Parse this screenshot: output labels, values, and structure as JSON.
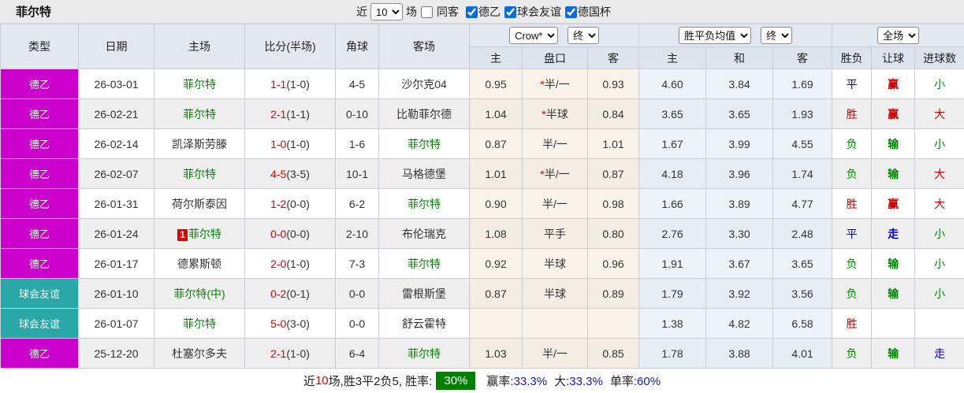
{
  "title": "菲尔特",
  "controls": {
    "near_label": "近",
    "games_select": "10",
    "games_label": "场",
    "same_away_label": "同客",
    "filters": [
      {
        "label": "德乙",
        "checked": true
      },
      {
        "label": "球会友谊",
        "checked": true
      },
      {
        "label": "德国杯",
        "checked": true
      }
    ]
  },
  "header": {
    "type": "类型",
    "date": "日期",
    "home": "主场",
    "score": "比分(半场)",
    "corner": "角球",
    "away": "客场",
    "odds_select": "Crow*",
    "odds_final_select": "终",
    "avg_select": "胜平负均值",
    "avg_final_select": "终",
    "scope_select": "全场",
    "odds_home": "主",
    "odds_handicap": "盘口",
    "odds_away": "客",
    "avg_home": "主",
    "avg_draw": "和",
    "avg_away": "客",
    "wl": "胜负",
    "handicap_res": "让球",
    "goals_res": "进球数"
  },
  "highlight_team": "菲尔特",
  "colors": {
    "type_map": {
      "德乙": "#cc00cc",
      "球会友谊": "#2aa7a7"
    },
    "result_map": {
      "胜": "#cc0000",
      "赢": "#cc0000",
      "大": "#cc0000",
      "负": "#008800",
      "输": "#008800",
      "小": "#008800",
      "平": "#0000cc",
      "走": "#0000cc"
    },
    "team_highlight": "#008800",
    "score_ft": "#e40000",
    "win_rate_badge_bg": "#008000"
  },
  "rows": [
    {
      "type": "德乙",
      "date": "26-03-01",
      "badge": "",
      "home": "菲尔特",
      "ft": "1-1",
      "ht": "(1-0)",
      "corner": "4-5",
      "away": "沙尔克04",
      "o1": "0.95",
      "star": "*",
      "pan": "半/一",
      "o2": "0.93",
      "a1": "4.60",
      "a2": "3.84",
      "a3": "1.69",
      "wl": "平",
      "hr": "赢",
      "gr": "小"
    },
    {
      "type": "德乙",
      "date": "26-02-21",
      "badge": "",
      "home": "菲尔特",
      "ft": "2-1",
      "ht": "(1-1)",
      "corner": "0-10",
      "away": "比勒菲尔德",
      "o1": "1.04",
      "star": "*",
      "pan": "半球",
      "o2": "0.84",
      "a1": "3.65",
      "a2": "3.65",
      "a3": "1.93",
      "wl": "胜",
      "hr": "赢",
      "gr": "大"
    },
    {
      "type": "德乙",
      "date": "26-02-14",
      "badge": "",
      "home": "凯泽斯劳滕",
      "ft": "1-0",
      "ht": "(1-0)",
      "corner": "1-6",
      "away": "菲尔特",
      "o1": "0.87",
      "star": "",
      "pan": "半/一",
      "o2": "1.01",
      "a1": "1.67",
      "a2": "3.99",
      "a3": "4.55",
      "wl": "负",
      "hr": "输",
      "gr": "小"
    },
    {
      "type": "德乙",
      "date": "26-02-07",
      "badge": "",
      "home": "菲尔特",
      "ft": "4-5",
      "ht": "(3-5)",
      "corner": "10-1",
      "away": "马格德堡",
      "o1": "1.01",
      "star": "*",
      "pan": "半/一",
      "o2": "0.87",
      "a1": "4.18",
      "a2": "3.96",
      "a3": "1.74",
      "wl": "负",
      "hr": "输",
      "gr": "大"
    },
    {
      "type": "德乙",
      "date": "26-01-31",
      "badge": "",
      "home": "荷尔斯泰因",
      "ft": "1-2",
      "ht": "(0-0)",
      "corner": "6-2",
      "away": "菲尔特",
      "o1": "0.90",
      "star": "",
      "pan": "半/一",
      "o2": "0.98",
      "a1": "1.66",
      "a2": "3.89",
      "a3": "4.77",
      "wl": "胜",
      "hr": "赢",
      "gr": "大"
    },
    {
      "type": "德乙",
      "date": "26-01-24",
      "badge": "1",
      "home": "菲尔特",
      "ft": "0-0",
      "ht": "(0-0)",
      "corner": "2-10",
      "away": "布伦瑞克",
      "o1": "1.08",
      "star": "",
      "pan": "平手",
      "o2": "0.80",
      "a1": "2.76",
      "a2": "3.30",
      "a3": "2.48",
      "wl": "平",
      "hr": "走",
      "gr": "小"
    },
    {
      "type": "德乙",
      "date": "26-01-17",
      "badge": "",
      "home": "德累斯顿",
      "ft": "2-0",
      "ht": "(1-0)",
      "corner": "7-3",
      "away": "菲尔特",
      "o1": "0.92",
      "star": "",
      "pan": "半球",
      "o2": "0.96",
      "a1": "1.91",
      "a2": "3.67",
      "a3": "3.65",
      "wl": "负",
      "hr": "输",
      "gr": "小"
    },
    {
      "type": "球会友谊",
      "date": "26-01-10",
      "badge": "",
      "home": "菲尔特(中)",
      "ft": "0-2",
      "ht": "(0-1)",
      "corner": "0-0",
      "away": "雷根斯堡",
      "o1": "0.87",
      "star": "",
      "pan": "半球",
      "o2": "0.89",
      "a1": "1.79",
      "a2": "3.92",
      "a3": "3.56",
      "wl": "负",
      "hr": "输",
      "gr": "小"
    },
    {
      "type": "球会友谊",
      "date": "26-01-07",
      "badge": "",
      "home": "菲尔特",
      "ft": "5-0",
      "ht": "(3-0)",
      "corner": "0-0",
      "away": "舒云霍特",
      "o1": "",
      "star": "",
      "pan": "",
      "o2": "",
      "a1": "1.38",
      "a2": "4.82",
      "a3": "6.58",
      "wl": "胜",
      "hr": "",
      "gr": ""
    },
    {
      "type": "德乙",
      "date": "25-12-20",
      "badge": "",
      "home": "杜塞尔多夫",
      "ft": "2-1",
      "ht": "(1-0)",
      "corner": "6-4",
      "away": "菲尔特",
      "o1": "1.03",
      "star": "",
      "pan": "半/一",
      "o2": "0.85",
      "a1": "1.78",
      "a2": "3.88",
      "a3": "4.01",
      "wl": "负",
      "hr": "输",
      "gr": "走"
    }
  ],
  "footer": {
    "prefix": "近",
    "count": "10",
    "mid": "场,胜3平2负5, 胜率:",
    "win_rate": "30%",
    "stats": [
      {
        "label": "赢率",
        "value": ":33.3%"
      },
      {
        "label": "大",
        "value": ":33.3%"
      },
      {
        "label": "单率",
        "value": ":60%"
      }
    ]
  }
}
